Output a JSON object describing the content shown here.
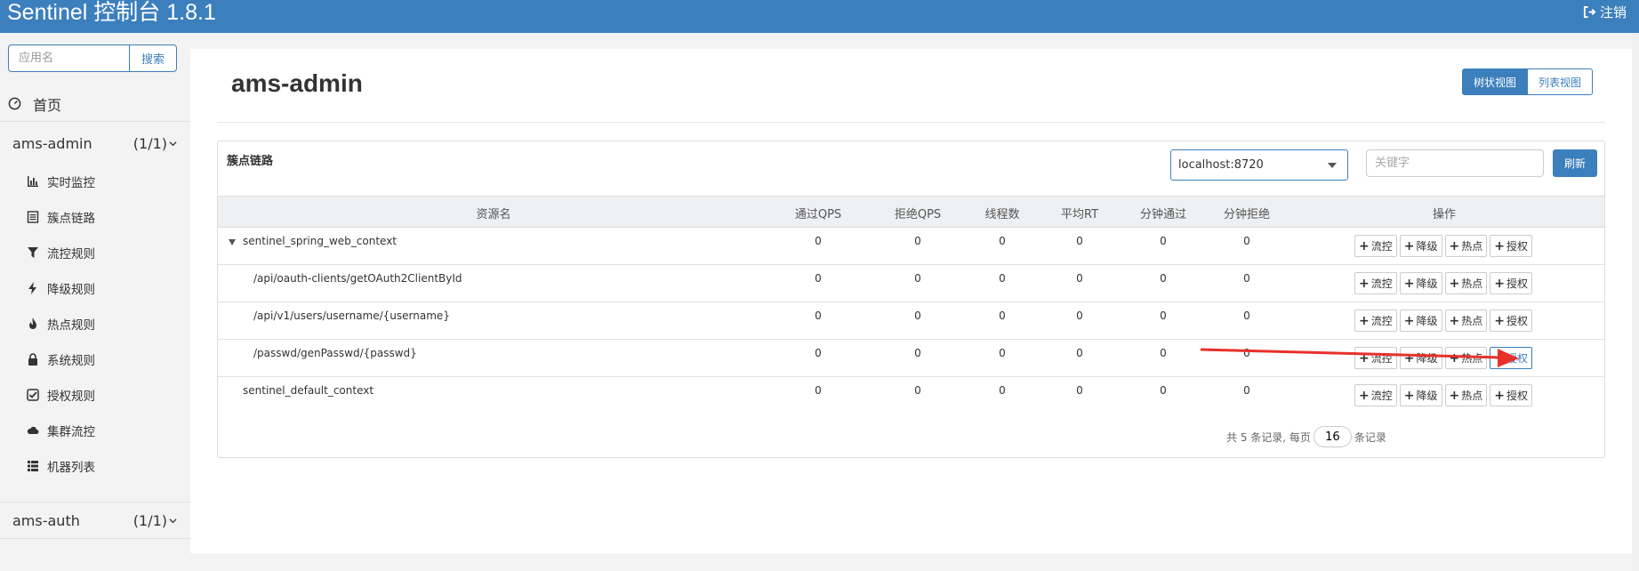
{
  "header": {
    "brand": "Sentinel 控制台 1.8.1",
    "logout": "注销"
  },
  "sidebar": {
    "search": {
      "placeholder": "应用名",
      "button": "搜索"
    },
    "home": "首页",
    "apps": [
      {
        "name": "ams-admin",
        "count": "(1/1)"
      },
      {
        "name": "ams-auth",
        "count": "(1/1)"
      }
    ],
    "menu": [
      {
        "label": "实时监控",
        "icon": "bar-chart-icon"
      },
      {
        "label": "簇点链路",
        "icon": "list-icon"
      },
      {
        "label": "流控规则",
        "icon": "filter-icon"
      },
      {
        "label": "降级规则",
        "icon": "flash-icon"
      },
      {
        "label": "热点规则",
        "icon": "fire-icon"
      },
      {
        "label": "系统规则",
        "icon": "lock-icon"
      },
      {
        "label": "授权规则",
        "icon": "check-square-icon"
      },
      {
        "label": "集群流控",
        "icon": "cloud-icon"
      },
      {
        "label": "机器列表",
        "icon": "th-list-icon"
      }
    ]
  },
  "main": {
    "title": "ams-admin",
    "views": {
      "tree": "树状视图",
      "list": "列表视图"
    },
    "card_title": "簇点链路",
    "machine": "localhost:8720",
    "keyword_placeholder": "关键字",
    "refresh": "刷新",
    "columns": [
      "资源名",
      "通过QPS",
      "拒绝QPS",
      "线程数",
      "平均RT",
      "分钟通过",
      "分钟拒绝",
      "操作"
    ],
    "rows": [
      {
        "name": "sentinel_spring_web_context",
        "values": [
          "0",
          "0",
          "0",
          "0",
          "0",
          "0"
        ]
      },
      {
        "name": "/api/oauth-clients/getOAuth2ClientById",
        "values": [
          "0",
          "0",
          "0",
          "0",
          "0",
          "0"
        ]
      },
      {
        "name": "/api/v1/users/username/{username}",
        "values": [
          "0",
          "0",
          "0",
          "0",
          "0",
          "0"
        ]
      },
      {
        "name": "/passwd/genPasswd/{passwd}",
        "values": [
          "0",
          "0",
          "0",
          "0",
          "0",
          "0"
        ]
      },
      {
        "name": "sentinel_default_context",
        "values": [
          "0",
          "0",
          "0",
          "0",
          "0",
          "0"
        ]
      }
    ],
    "actions": {
      "plus": "+",
      "flow": "流控",
      "degrade": "降级",
      "hot": "热点",
      "auth": "授权"
    },
    "pager": {
      "prefix": "共 5 条记录, 每页",
      "page_size": "16",
      "suffix": "条记录"
    }
  },
  "colors": {
    "brand": "#3c7fbd",
    "annotation_arrow": "#e8312a"
  }
}
